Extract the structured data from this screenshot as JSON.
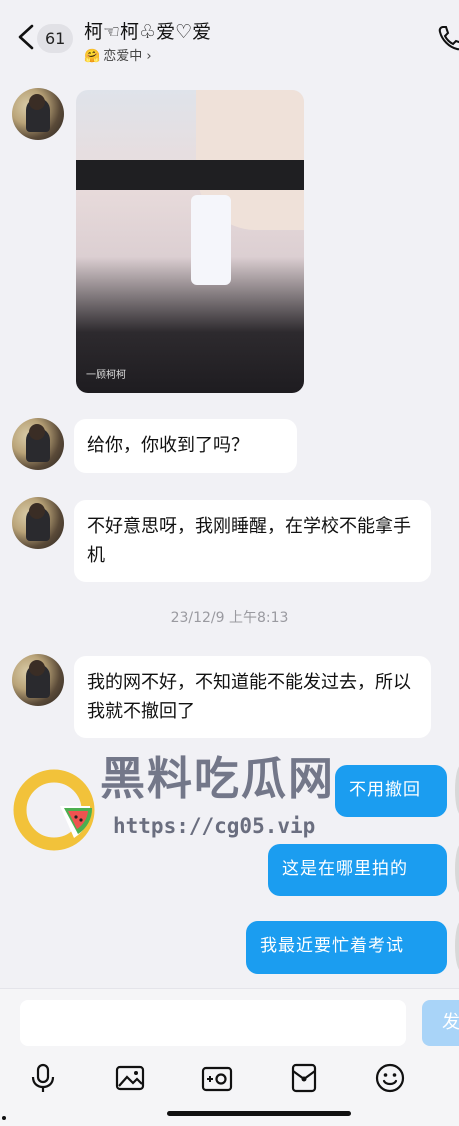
{
  "header": {
    "badge_count": "61",
    "title": "柯☜柯♧爱♡爱",
    "status_icon": "🤗",
    "status_text": "恋爱中 ›"
  },
  "messages": {
    "photo_watermark": "一顾柯柯",
    "m1": "给你，你收到了吗？",
    "m2": "不好意思呀，我刚睡醒，在学校不能拿手机",
    "timestamp": "23/12/9 上午8:13",
    "m3": "我的网不好，不知道能不能发过去，所以我就不撤回了",
    "r1": "不用撤回",
    "r2": "这是在哪里拍的",
    "r3": "我最近要忙着考试"
  },
  "watermark": {
    "title": "黑料吃瓜网",
    "url": "https://cg05.vip"
  },
  "composer": {
    "send_label": "发"
  },
  "icons": {
    "back": "chevron-left-icon",
    "phone": "phone-icon",
    "mic": "mic-icon",
    "image": "image-icon",
    "camera": "camera-icon",
    "red_packet": "red-packet-icon",
    "emoji": "emoji-icon"
  },
  "colors": {
    "bubble_me": "#1b9df0",
    "background": "#f1f1f5",
    "send_disabled": "#a9d4f8"
  }
}
